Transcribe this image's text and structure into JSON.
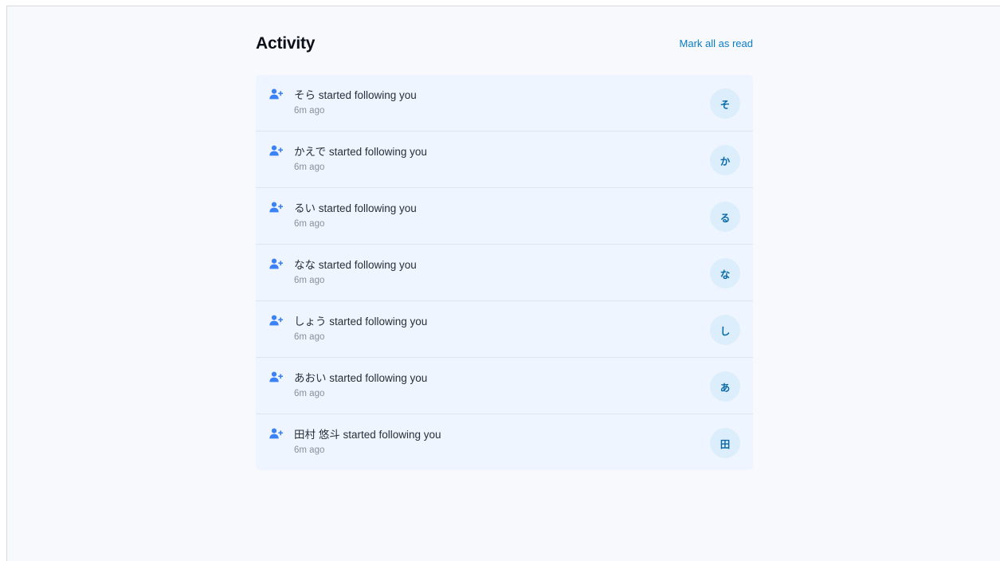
{
  "header": {
    "title": "Activity",
    "mark_all_label": "Mark all as read"
  },
  "icons": {
    "row_icon": "user-plus-icon"
  },
  "colors": {
    "accent": "#0b7cc4",
    "icon": "#3b82f6",
    "row_bg": "#eef5ff",
    "avatar_bg": "#dcedfb"
  },
  "notifications": [
    {
      "title": "そら started following you",
      "time": "6m ago",
      "avatar": "そ"
    },
    {
      "title": "かえで started following you",
      "time": "6m ago",
      "avatar": "か"
    },
    {
      "title": "るい started following you",
      "time": "6m ago",
      "avatar": "る"
    },
    {
      "title": "なな started following you",
      "time": "6m ago",
      "avatar": "な"
    },
    {
      "title": "しょう started following you",
      "time": "6m ago",
      "avatar": "し"
    },
    {
      "title": "あおい started following you",
      "time": "6m ago",
      "avatar": "あ"
    },
    {
      "title": "田村 悠斗 started following you",
      "time": "6m ago",
      "avatar": "田"
    }
  ]
}
